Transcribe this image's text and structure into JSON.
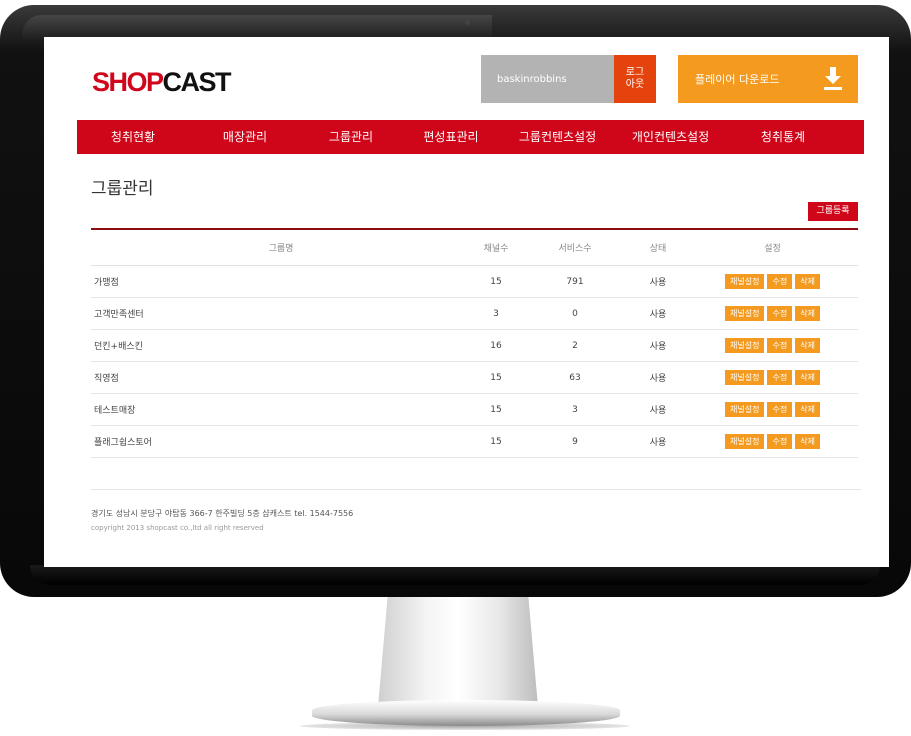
{
  "logo": {
    "part1": "SHOP",
    "part2": "CAST"
  },
  "header": {
    "username": "baskinrobbins",
    "logout_label": "로그\n아웃",
    "download_label": "플레이어 다운로드",
    "download_icon": "download-icon"
  },
  "nav": {
    "items": [
      {
        "label": "청취현황"
      },
      {
        "label": "매장관리"
      },
      {
        "label": "그룹관리"
      },
      {
        "label": "편성표관리"
      },
      {
        "label": "그룹컨텐츠설정"
      },
      {
        "label": "개인컨텐츠설정"
      },
      {
        "label": "청취통계"
      }
    ]
  },
  "page": {
    "title": "그룹관리",
    "register_label": "그룹등록"
  },
  "table": {
    "headers": {
      "name": "그룹명",
      "channels": "채널수",
      "services": "서비스수",
      "status": "상태",
      "settings": "설정"
    },
    "actions": {
      "channel": "채널설정",
      "edit": "수정",
      "delete": "삭제"
    },
    "rows": [
      {
        "name": "가맹점",
        "channels": "15",
        "services": "791",
        "status": "사용"
      },
      {
        "name": "고객만족센터",
        "channels": "3",
        "services": "0",
        "status": "사용"
      },
      {
        "name": "던킨+배스킨",
        "channels": "16",
        "services": "2",
        "status": "사용"
      },
      {
        "name": "직영점",
        "channels": "15",
        "services": "63",
        "status": "사용"
      },
      {
        "name": "테스트매장",
        "channels": "15",
        "services": "3",
        "status": "사용"
      },
      {
        "name": "플래그쉽스토어",
        "channels": "15",
        "services": "9",
        "status": "사용"
      }
    ]
  },
  "footer": {
    "address": "경기도 성남시 분당구 야탑동 366-7 한주빌딩 5층 샵캐스트 tel. 1544-7556",
    "copyright": "copyright 2013 shopcast co.,ltd all right reserved"
  },
  "colors": {
    "brand_red": "#cf0519",
    "orange": "#f39a1f",
    "logout_orange": "#e4430d",
    "user_gray": "#b3b3b3"
  }
}
